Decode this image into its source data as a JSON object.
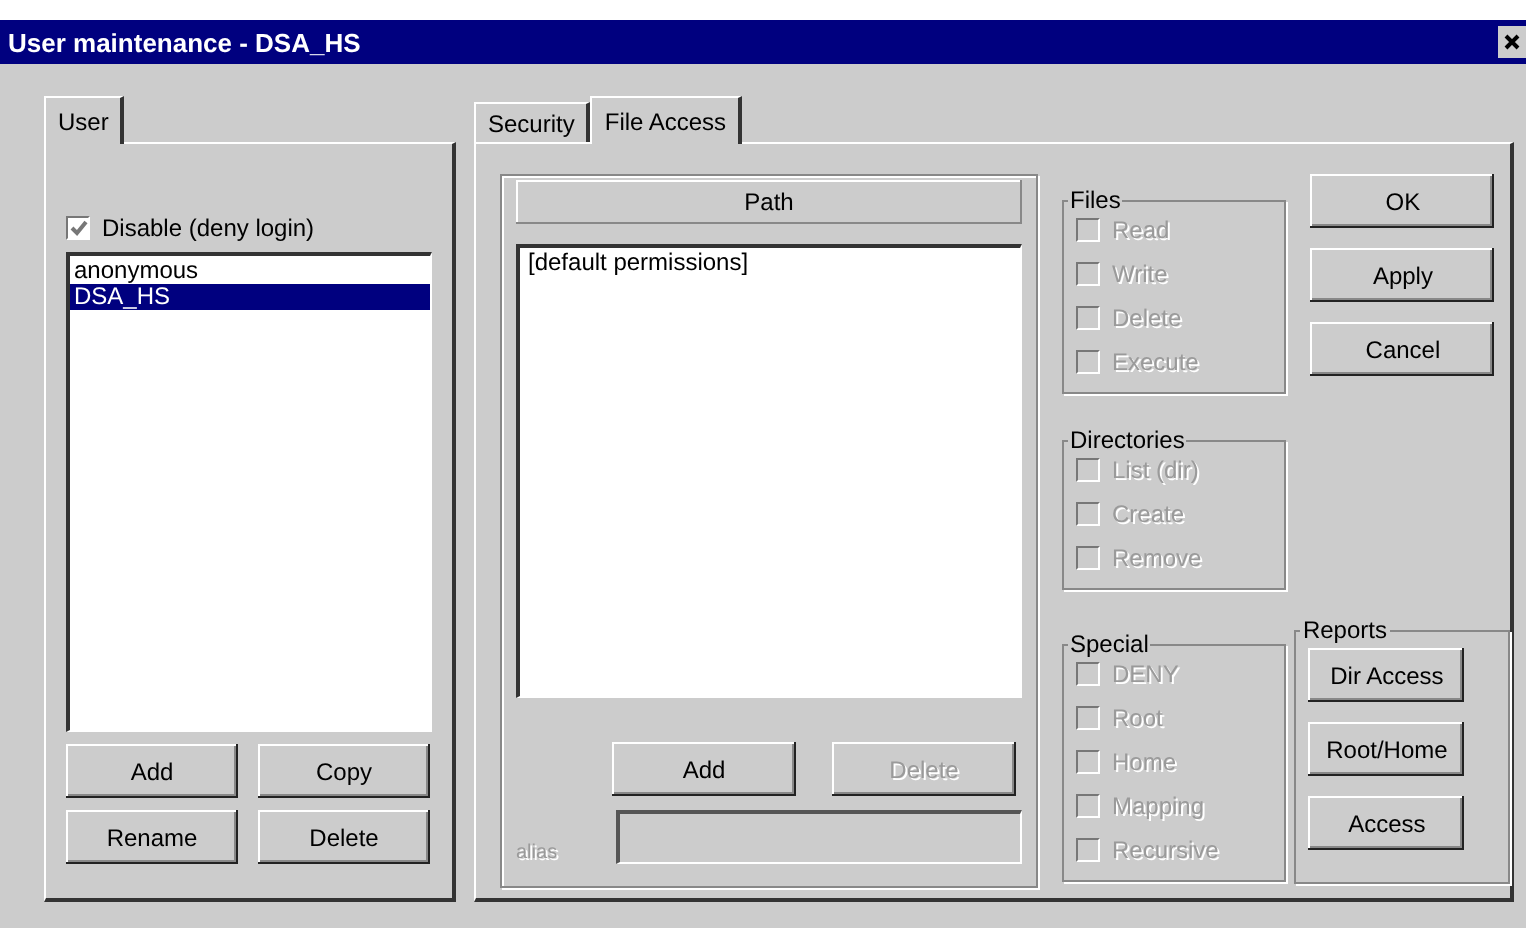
{
  "window": {
    "title": "User maintenance - DSA_HS"
  },
  "user_panel": {
    "tabs": [
      {
        "label": "User",
        "selected": true
      }
    ],
    "disable_login": {
      "label": "Disable (deny login)",
      "checked": true
    },
    "users": [
      {
        "name": "anonymous",
        "selected": false
      },
      {
        "name": "DSA_HS",
        "selected": true
      }
    ],
    "buttons": [
      "Add",
      "Copy",
      "Rename",
      "Delete"
    ]
  },
  "access_panel": {
    "tabs": [
      {
        "label": "Security",
        "selected": false
      },
      {
        "label": "File Access",
        "selected": true
      }
    ],
    "path_header": "Path",
    "paths": [
      {
        "name": "[default permissions]",
        "selected": false
      }
    ],
    "buttons": [
      {
        "label": "Add",
        "disabled": false
      },
      {
        "label": "Delete",
        "disabled": true
      }
    ],
    "alias": {
      "label": "alias",
      "disabled": true
    },
    "groups": [
      {
        "title": "Files",
        "items": [
          {
            "label": "Read",
            "checked": false,
            "disabled": true
          },
          {
            "label": "Write",
            "checked": false,
            "disabled": true
          },
          {
            "label": "Delete",
            "checked": false,
            "disabled": true
          },
          {
            "label": "Execute",
            "checked": false,
            "disabled": true
          }
        ]
      },
      {
        "title": "Directories",
        "items": [
          {
            "label": "List (dir)",
            "checked": false,
            "disabled": true
          },
          {
            "label": "Create",
            "checked": false,
            "disabled": true
          },
          {
            "label": "Remove",
            "checked": false,
            "disabled": true
          }
        ]
      },
      {
        "title": "Special",
        "items": [
          {
            "label": "DENY",
            "checked": false,
            "disabled": true
          },
          {
            "label": "Root",
            "checked": false,
            "disabled": true
          },
          {
            "label": "Home",
            "checked": false,
            "disabled": true
          },
          {
            "label": "Mapping",
            "checked": false,
            "disabled": true
          },
          {
            "label": "Recursive",
            "checked": false,
            "disabled": true
          }
        ]
      }
    ],
    "dialog_buttons": [
      "OK",
      "Apply",
      "Cancel"
    ],
    "reports": {
      "title": "Reports",
      "buttons": [
        "Dir Access",
        "Root/Home",
        "Access"
      ]
    }
  }
}
